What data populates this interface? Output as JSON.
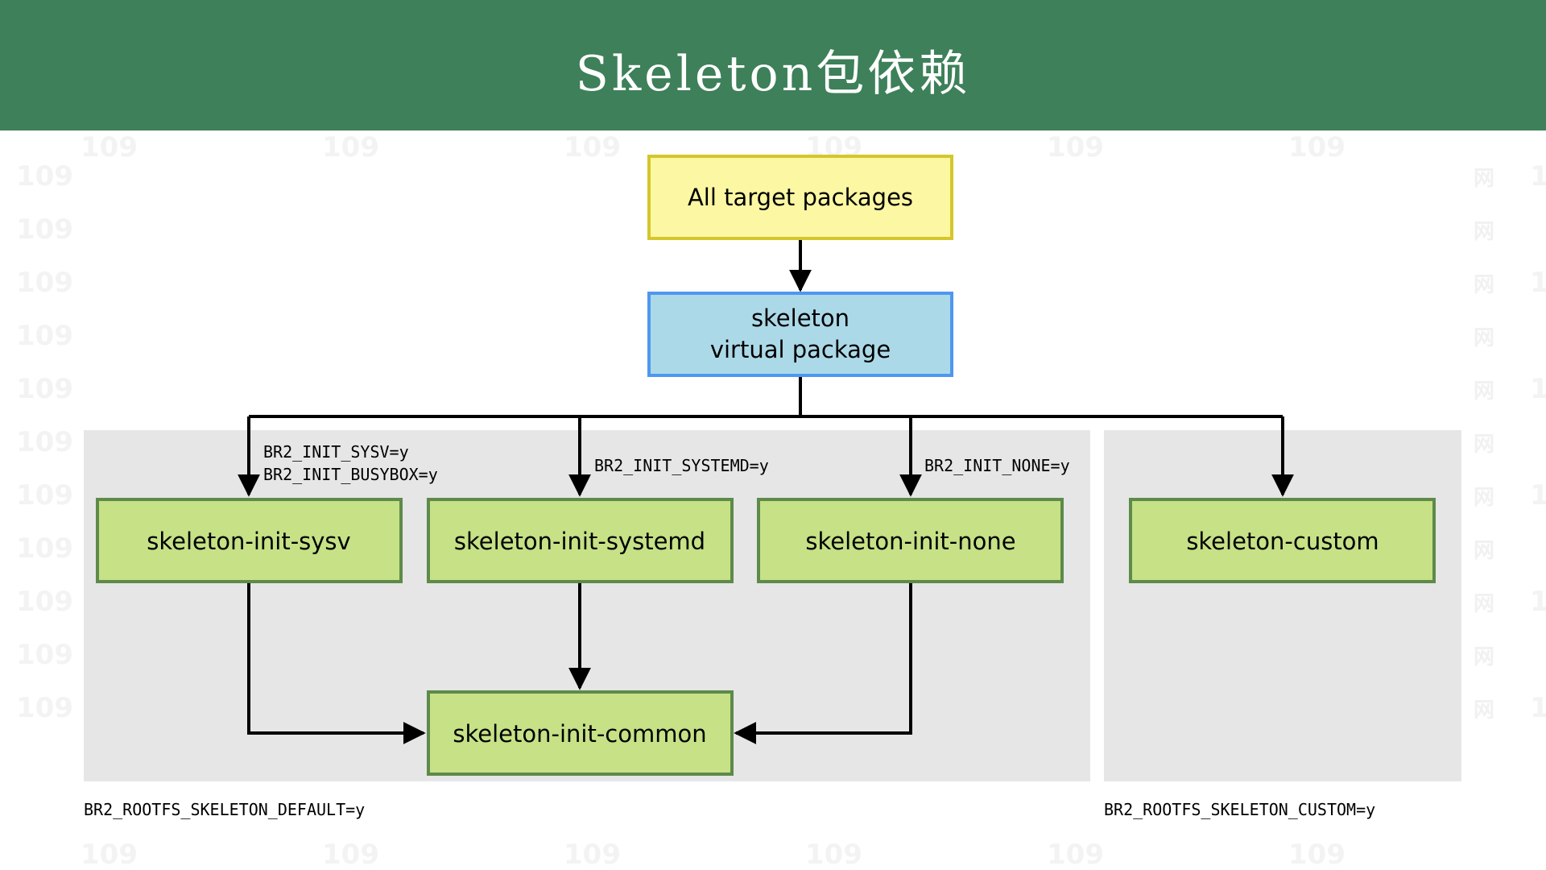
{
  "header": {
    "title": "Skeleton包依赖"
  },
  "diagram": {
    "nodes": {
      "target": "All target packages",
      "skeleton_line1": "skeleton",
      "skeleton_line2": "virtual package",
      "sysv": "skeleton-init-sysv",
      "systemd": "skeleton-init-systemd",
      "none": "skeleton-init-none",
      "custom": "skeleton-custom",
      "common": "skeleton-init-common"
    },
    "conditions": {
      "sysv_line1": "BR2_INIT_SYSV=y",
      "sysv_line2": "BR2_INIT_BUSYBOX=y",
      "systemd": "BR2_INIT_SYSTEMD=y",
      "none": "BR2_INIT_NONE=y"
    },
    "groups": {
      "default": "BR2_ROOTFS_SKELETON_DEFAULT=y",
      "custom": "BR2_ROOTFS_SKELETON_CUSTOM=y"
    }
  },
  "colors": {
    "header": "#3d8059",
    "target_fill": "#fbf7a3",
    "target_border": "#d4c62c",
    "skeleton_fill": "#acd9e8",
    "skeleton_border": "#4f97f0",
    "leaf_fill": "#c6e186",
    "leaf_border": "#5e8a4a",
    "group_fill": "#e6e6e6"
  }
}
